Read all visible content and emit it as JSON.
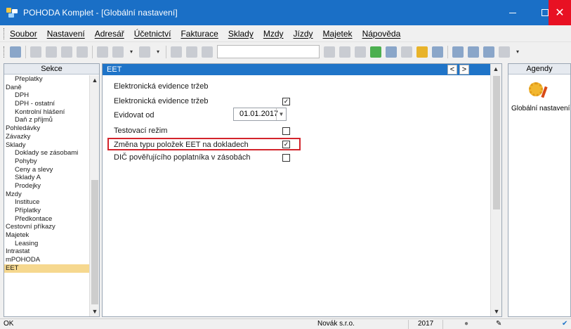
{
  "window": {
    "title": "POHODA Komplet - [Globální nastavení]",
    "minimize_label": "—",
    "close_label": "✕"
  },
  "menu": {
    "items": [
      "Soubor",
      "Nastavení",
      "Adresář",
      "Účetnictví",
      "Fakturace",
      "Sklady",
      "Mzdy",
      "Jízdy",
      "Majetek",
      "Nápověda"
    ]
  },
  "sections": {
    "header": "Sekce",
    "items": [
      {
        "label": "Přeplatky",
        "level": 1
      },
      {
        "label": "Daně",
        "level": 0
      },
      {
        "label": "DPH",
        "level": 1
      },
      {
        "label": "DPH - ostatní",
        "level": 1
      },
      {
        "label": "Kontrolní hlášení",
        "level": 1
      },
      {
        "label": "Daň z příjmů",
        "level": 1
      },
      {
        "label": "Pohledávky",
        "level": 0
      },
      {
        "label": "Závazky",
        "level": 0
      },
      {
        "label": "Sklady",
        "level": 0
      },
      {
        "label": "Doklady se zásobami",
        "level": 1
      },
      {
        "label": "Pohyby",
        "level": 1
      },
      {
        "label": "Ceny a slevy",
        "level": 1
      },
      {
        "label": "Sklady A",
        "level": 1
      },
      {
        "label": "Prodejky",
        "level": 1
      },
      {
        "label": "Mzdy",
        "level": 0
      },
      {
        "label": "Instituce",
        "level": 1
      },
      {
        "label": "Příplatky",
        "level": 1
      },
      {
        "label": "Předkontace",
        "level": 1
      },
      {
        "label": "Cestovní příkazy",
        "level": 0
      },
      {
        "label": "Majetek",
        "level": 0
      },
      {
        "label": "Leasing",
        "level": 1
      },
      {
        "label": "Intrastat",
        "level": 0
      },
      {
        "label": "mPOHODA",
        "level": 0
      },
      {
        "label": "EET",
        "level": 0,
        "selected": true
      }
    ]
  },
  "main": {
    "header": "EET",
    "nav_prev": "<",
    "nav_next": ">",
    "section_title": "Elektronická evidence tržeb",
    "fields": [
      {
        "label": "Elektronická evidence tržeb",
        "type": "checkbox",
        "checked": true
      },
      {
        "label": "Evidovat od",
        "type": "date",
        "value": "01.01.2017"
      },
      {
        "label": "Testovací režim",
        "type": "checkbox",
        "checked": false
      },
      {
        "label": "Změna typu položek EET na dokladech",
        "type": "checkbox",
        "checked": true,
        "highlighted": true
      },
      {
        "label": "DIČ pověřujícího poplatníka v zásobách",
        "type": "checkbox",
        "checked": false
      }
    ]
  },
  "agendy": {
    "header": "Agendy",
    "items": [
      {
        "label": "Globální nastavení",
        "icon": "settings-gear-icon"
      }
    ]
  },
  "status": {
    "left": "OK",
    "company": "Novák s.r.o.",
    "year": "2017"
  },
  "colors": {
    "titlebar": "#1a6fc6",
    "close_button": "#e81123",
    "panel_header": "#1f74c8",
    "selected_item": "#f6d88f",
    "highlight_border": "#d3242c"
  }
}
